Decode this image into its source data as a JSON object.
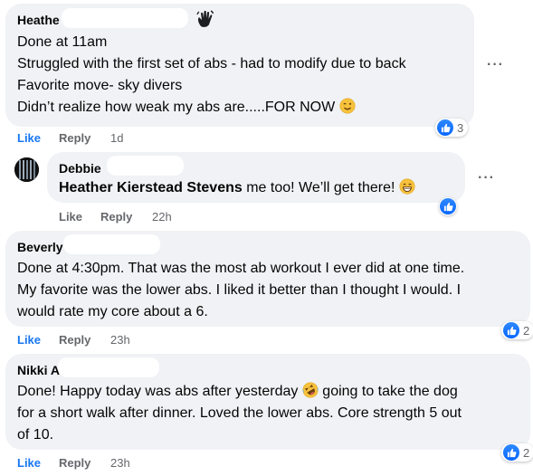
{
  "colors": {
    "bubble": "#f0f2f5",
    "like_blue": "#1877f2",
    "meta_gray": "#65676b"
  },
  "comments": [
    {
      "author": "Heathe",
      "lines": [
        "Done at 11am",
        "Struggled with the first set of abs - had to modify due to back",
        "Favorite move- sky divers",
        "Didn’t realize how weak my abs are.....FOR NOW"
      ],
      "like_label": "Like",
      "reply_label": "Reply",
      "time": "1d",
      "reaction_count": "3",
      "more_label": "···"
    },
    {
      "author": "Debbie",
      "mention": "Heather Kierstead Stevens",
      "text": " me too! We’ll get there!",
      "like_label": "Like",
      "reply_label": "Reply",
      "time": "22h",
      "more_label": "···"
    },
    {
      "author": "Beverly",
      "lines": [
        "Done at 4:30pm. That was the most ab workout I ever did at one time.",
        "My favorite was the lower abs. I liked it better than I thought I would. I",
        "would rate my core about a 6."
      ],
      "like_label": "Like",
      "reply_label": "Reply",
      "time": "23h",
      "reaction_count": "2"
    },
    {
      "author": "Nikki A",
      "lines": [
        "Done! Happy today was abs after yesterday",
        " going to take the dog",
        "for a short walk after dinner. Loved the lower abs. Core strength 5 out",
        "of 10."
      ],
      "like_label": "Like",
      "reply_label": "Reply",
      "time": "23h",
      "reaction_count": "2"
    }
  ]
}
